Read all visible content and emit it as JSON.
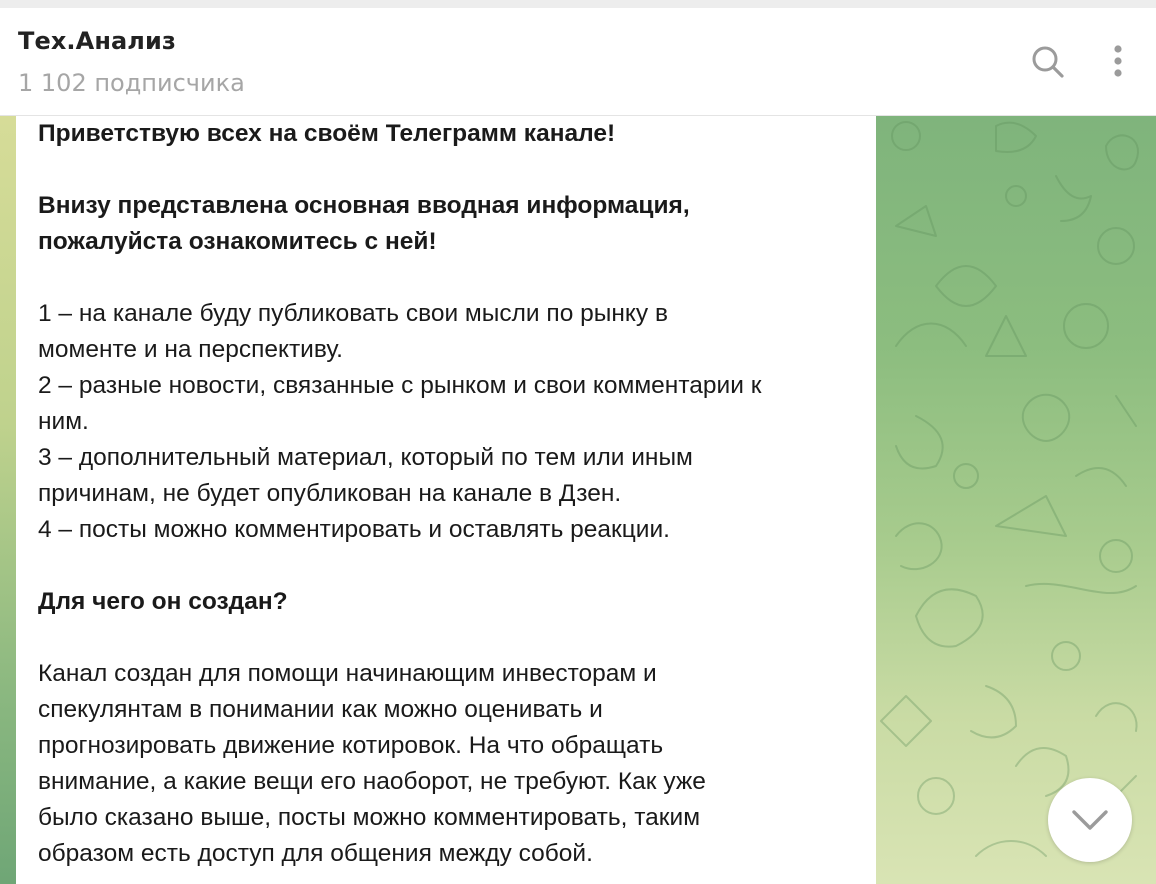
{
  "header": {
    "title": "Тех.Анализ",
    "subscribers": "1 102 подписчика",
    "icons": [
      "search-icon",
      "more-vertical-icon"
    ]
  },
  "message": {
    "lines": [
      "Приветствую всех на своём Телеграмм канале!",
      "Внизу представлена основная вводная информация,",
      "пожалуйста ознакомитесь с ней!",
      "1 – на канале буду публиковать свои мысли по рынку в",
      "моменте и на перспективу.",
      "2 – разные новости, связанные с рынком и свои комментарии к",
      "ним.",
      "3 – дополнительный материал, который по тем или иным",
      "причинам, не будет опубликован на канале в Дзен.",
      "4 – посты можно комментировать и оставлять реакции.",
      "Для чего он создан?",
      "Канал создан для помощи начинающим инвесторам и",
      "спекулянтам в понимании как можно оценивать и",
      "прогнозировать движение котировок. На что обращать",
      "внимание, а какие вещи его наоборот, не требуют. Как уже",
      "было сказано выше, посты можно комментировать, таким",
      "образом есть доступ для общения между собой."
    ]
  },
  "scroll_button": {
    "icon": "chevron-down-icon"
  },
  "colors": {
    "header_bg": "#ffffff",
    "title": "#222222",
    "subtitle": "#a6a6a6",
    "icon": "#999999",
    "wallpaper_top": "#7fb47c",
    "wallpaper_bottom": "#d9e4b4",
    "bubble_bg": "#ffffff",
    "text": "#1a1a1a"
  }
}
